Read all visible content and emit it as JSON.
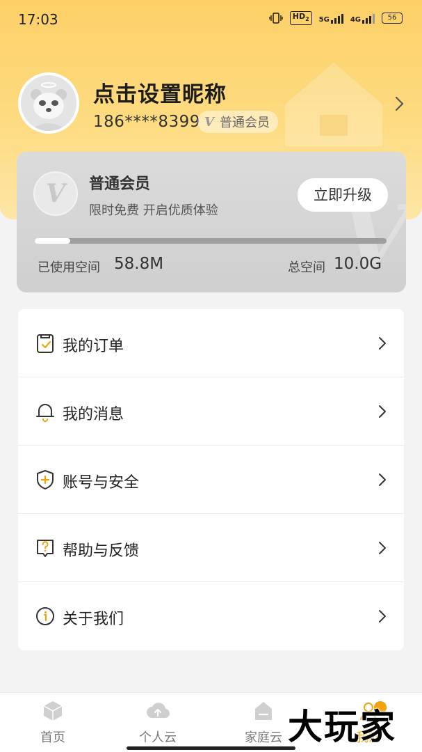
{
  "status_bar": {
    "time": "17:03",
    "hd": "HD",
    "hd_sub": "2",
    "net1": "5G",
    "net2": "4G",
    "battery": "56"
  },
  "profile": {
    "nickname": "点击设置昵称",
    "phone": "186****8399",
    "member_tag": "普通会员",
    "member_tag_mark": "V"
  },
  "vip_card": {
    "badge_mark": "V",
    "watermark": "V",
    "title": "普通会员",
    "subtitle": "限时免费 开启优质体验",
    "upgrade_label": "立即升级",
    "storage_used_fraction": 0.1,
    "used_label": "已使用空间",
    "used_value": "58.8M",
    "total_label": "总空间",
    "total_value": "10.0G"
  },
  "menu": {
    "items": [
      {
        "label": "我的订单",
        "icon": "order-icon"
      },
      {
        "label": "我的消息",
        "icon": "bell-icon"
      },
      {
        "label": "账号与安全",
        "icon": "shield-icon"
      },
      {
        "label": "帮助与反馈",
        "icon": "help-icon"
      },
      {
        "label": "关于我们",
        "icon": "info-icon"
      }
    ]
  },
  "tabbar": {
    "items": [
      {
        "label": "首页",
        "icon": "cube-icon"
      },
      {
        "label": "个人云",
        "icon": "cloud-upload-icon"
      },
      {
        "label": "家庭云",
        "icon": "home-cloud-icon"
      },
      {
        "label": "我的",
        "icon": "profile-icon",
        "active": true
      }
    ]
  },
  "overlay_watermark": "大玩家",
  "colors": {
    "hero": "#fdd067",
    "accent": "#f2a20b",
    "card_gray": "#d5d5d5"
  }
}
